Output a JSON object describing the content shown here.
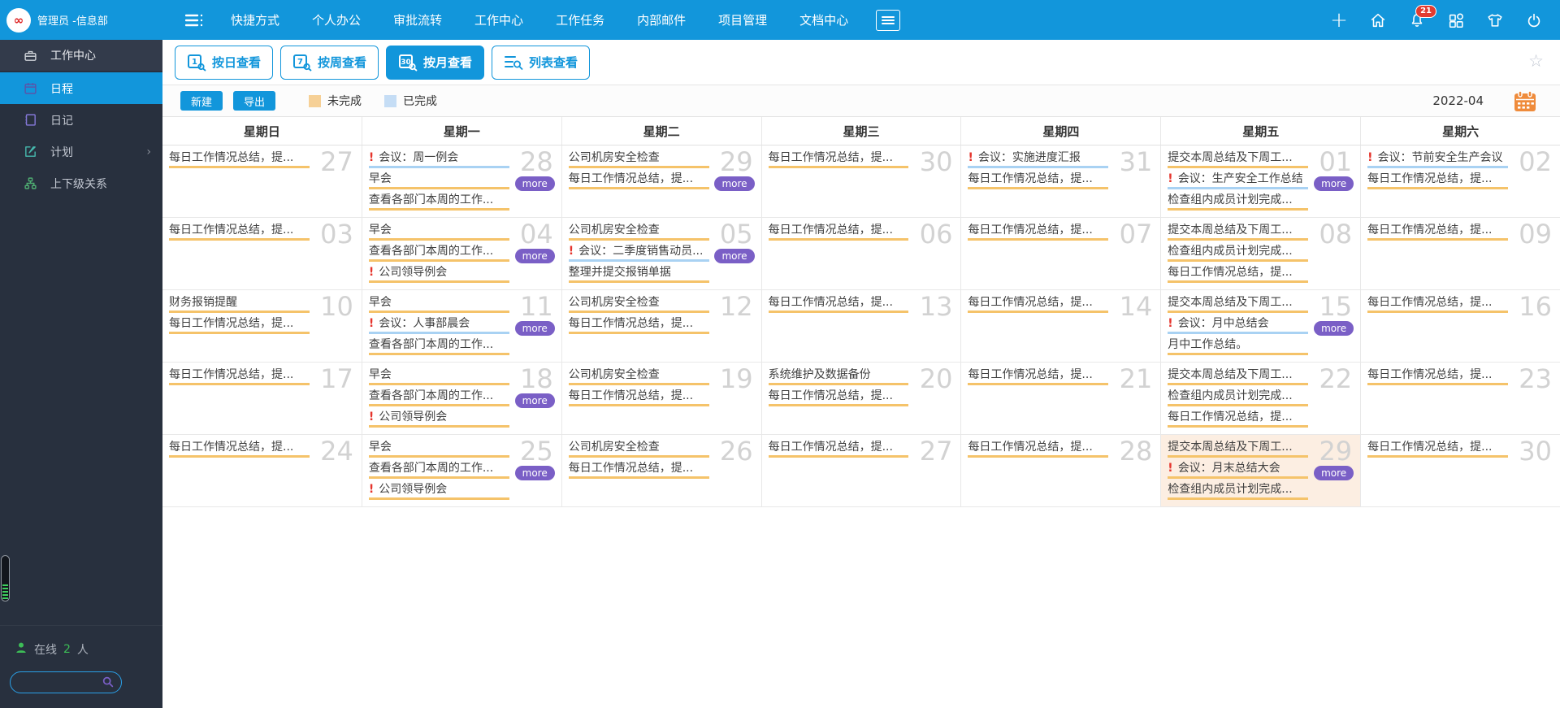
{
  "topbar": {
    "user": "管理员 -信息部",
    "nav_items": [
      "快捷方式",
      "个人办公",
      "审批流转",
      "工作中心",
      "工作任务",
      "内部邮件",
      "项目管理",
      "文档中心"
    ],
    "plus_glyph": "+",
    "notification_count": "21",
    "logo_glyph": "∞"
  },
  "sidebar": {
    "items": [
      {
        "label": "工作中心",
        "icon": "briefcase-icon"
      },
      {
        "label": "日程",
        "icon": "schedule-icon",
        "active": true
      },
      {
        "label": "日记",
        "icon": "diary-icon"
      },
      {
        "label": "计划",
        "icon": "plan-icon",
        "chevron": "›"
      },
      {
        "label": "上下级关系",
        "icon": "hierarchy-icon"
      }
    ],
    "online_label": "在线",
    "online_count": "2",
    "online_unit": "人",
    "search_value": ""
  },
  "toolbar": {
    "view_buttons": [
      {
        "label": "按日查看",
        "badge": "1",
        "active": false
      },
      {
        "label": "按周查看",
        "badge": "7",
        "active": false
      },
      {
        "label": "按月查看",
        "badge": "30",
        "active": true
      },
      {
        "label": "列表查看",
        "badge": "",
        "active": false
      }
    ],
    "new_label": "新建",
    "export_label": "导出",
    "legend": [
      {
        "label": "未完成",
        "color": "#f6d096"
      },
      {
        "label": "已完成",
        "color": "#c5ddf5"
      }
    ],
    "current_month": "2022-04",
    "favorite_glyph": "☆"
  },
  "calendar": {
    "weekday_headers": [
      "星期日",
      "星期一",
      "星期二",
      "星期三",
      "星期四",
      "星期五",
      "星期六"
    ],
    "more_label": "more",
    "important_marker": "!",
    "weeks": [
      [
        {
          "day": "27",
          "events": [
            {
              "text": "每日工作情况总结，提...",
              "status": "incomplete",
              "important": false
            }
          ],
          "more": false,
          "today": false
        },
        {
          "day": "28",
          "events": [
            {
              "text": "会议：周一例会",
              "status": "complete",
              "important": true
            },
            {
              "text": "早会",
              "status": "incomplete",
              "important": false
            },
            {
              "text": "查看各部门本周的工作...",
              "status": "incomplete",
              "important": false
            }
          ],
          "more": true,
          "today": false
        },
        {
          "day": "29",
          "events": [
            {
              "text": "公司机房安全检查",
              "status": "incomplete",
              "important": false
            },
            {
              "text": "每日工作情况总结，提...",
              "status": "incomplete",
              "important": false
            }
          ],
          "more": true,
          "today": false
        },
        {
          "day": "30",
          "events": [
            {
              "text": "每日工作情况总结，提...",
              "status": "incomplete",
              "important": false
            }
          ],
          "more": false,
          "today": false
        },
        {
          "day": "31",
          "events": [
            {
              "text": "会议：实施进度汇报",
              "status": "complete",
              "important": true
            },
            {
              "text": "每日工作情况总结，提...",
              "status": "incomplete",
              "important": false
            }
          ],
          "more": false,
          "today": false
        },
        {
          "day": "01",
          "events": [
            {
              "text": "提交本周总结及下周工...",
              "status": "incomplete",
              "important": false
            },
            {
              "text": "会议：生产安全工作总结",
              "status": "complete",
              "important": true
            },
            {
              "text": "检查组内成员计划完成...",
              "status": "incomplete",
              "important": false
            }
          ],
          "more": true,
          "today": false
        },
        {
          "day": "02",
          "events": [
            {
              "text": "会议：节前安全生产会议",
              "status": "complete",
              "important": true
            },
            {
              "text": "每日工作情况总结，提...",
              "status": "incomplete",
              "important": false
            }
          ],
          "more": false,
          "today": false
        }
      ],
      [
        {
          "day": "03",
          "events": [
            {
              "text": "每日工作情况总结，提...",
              "status": "incomplete",
              "important": false
            }
          ],
          "more": false,
          "today": false
        },
        {
          "day": "04",
          "events": [
            {
              "text": "早会",
              "status": "incomplete",
              "important": false
            },
            {
              "text": "查看各部门本周的工作...",
              "status": "incomplete",
              "important": false
            },
            {
              "text": "公司领导例会",
              "status": "incomplete",
              "important": true
            }
          ],
          "more": true,
          "today": false
        },
        {
          "day": "05",
          "events": [
            {
              "text": "公司机房安全检查",
              "status": "incomplete",
              "important": false
            },
            {
              "text": "会议：二季度销售动员...",
              "status": "complete",
              "important": true
            },
            {
              "text": "整理并提交报销单据",
              "status": "incomplete",
              "important": false
            }
          ],
          "more": true,
          "today": false
        },
        {
          "day": "06",
          "events": [
            {
              "text": "每日工作情况总结，提...",
              "status": "incomplete",
              "important": false
            }
          ],
          "more": false,
          "today": false
        },
        {
          "day": "07",
          "events": [
            {
              "text": "每日工作情况总结，提...",
              "status": "incomplete",
              "important": false
            }
          ],
          "more": false,
          "today": false
        },
        {
          "day": "08",
          "events": [
            {
              "text": "提交本周总结及下周工...",
              "status": "incomplete",
              "important": false
            },
            {
              "text": "检查组内成员计划完成...",
              "status": "incomplete",
              "important": false
            },
            {
              "text": "每日工作情况总结，提...",
              "status": "incomplete",
              "important": false
            }
          ],
          "more": false,
          "today": false
        },
        {
          "day": "09",
          "events": [
            {
              "text": "每日工作情况总结，提...",
              "status": "incomplete",
              "important": false
            }
          ],
          "more": false,
          "today": false
        }
      ],
      [
        {
          "day": "10",
          "events": [
            {
              "text": "财务报销提醒",
              "status": "incomplete",
              "important": false
            },
            {
              "text": "每日工作情况总结，提...",
              "status": "incomplete",
              "important": false
            }
          ],
          "more": false,
          "today": false
        },
        {
          "day": "11",
          "events": [
            {
              "text": "早会",
              "status": "incomplete",
              "important": false
            },
            {
              "text": "会议：人事部晨会",
              "status": "complete",
              "important": true
            },
            {
              "text": "查看各部门本周的工作...",
              "status": "incomplete",
              "important": false
            }
          ],
          "more": true,
          "today": false
        },
        {
          "day": "12",
          "events": [
            {
              "text": "公司机房安全检查",
              "status": "incomplete",
              "important": false
            },
            {
              "text": "每日工作情况总结，提...",
              "status": "incomplete",
              "important": false
            }
          ],
          "more": false,
          "today": false
        },
        {
          "day": "13",
          "events": [
            {
              "text": "每日工作情况总结，提...",
              "status": "incomplete",
              "important": false
            }
          ],
          "more": false,
          "today": false
        },
        {
          "day": "14",
          "events": [
            {
              "text": "每日工作情况总结，提...",
              "status": "incomplete",
              "important": false
            }
          ],
          "more": false,
          "today": false
        },
        {
          "day": "15",
          "events": [
            {
              "text": "提交本周总结及下周工...",
              "status": "incomplete",
              "important": false
            },
            {
              "text": "会议：月中总结会",
              "status": "complete",
              "important": true
            },
            {
              "text": "月中工作总结。",
              "status": "incomplete",
              "important": false
            }
          ],
          "more": true,
          "today": false
        },
        {
          "day": "16",
          "events": [
            {
              "text": "每日工作情况总结，提...",
              "status": "incomplete",
              "important": false
            }
          ],
          "more": false,
          "today": false
        }
      ],
      [
        {
          "day": "17",
          "events": [
            {
              "text": "每日工作情况总结，提...",
              "status": "incomplete",
              "important": false
            }
          ],
          "more": false,
          "today": false
        },
        {
          "day": "18",
          "events": [
            {
              "text": "早会",
              "status": "incomplete",
              "important": false
            },
            {
              "text": "查看各部门本周的工作...",
              "status": "incomplete",
              "important": false
            },
            {
              "text": "公司领导例会",
              "status": "incomplete",
              "important": true
            }
          ],
          "more": true,
          "today": false
        },
        {
          "day": "19",
          "events": [
            {
              "text": "公司机房安全检查",
              "status": "incomplete",
              "important": false
            },
            {
              "text": "每日工作情况总结，提...",
              "status": "incomplete",
              "important": false
            }
          ],
          "more": false,
          "today": false
        },
        {
          "day": "20",
          "events": [
            {
              "text": "系统维护及数据备份",
              "status": "incomplete",
              "important": false
            },
            {
              "text": "每日工作情况总结，提...",
              "status": "incomplete",
              "important": false
            }
          ],
          "more": false,
          "today": false
        },
        {
          "day": "21",
          "events": [
            {
              "text": "每日工作情况总结，提...",
              "status": "incomplete",
              "important": false
            }
          ],
          "more": false,
          "today": false
        },
        {
          "day": "22",
          "events": [
            {
              "text": "提交本周总结及下周工...",
              "status": "incomplete",
              "important": false
            },
            {
              "text": "检查组内成员计划完成...",
              "status": "incomplete",
              "important": false
            },
            {
              "text": "每日工作情况总结，提...",
              "status": "incomplete",
              "important": false
            }
          ],
          "more": false,
          "today": false
        },
        {
          "day": "23",
          "events": [
            {
              "text": "每日工作情况总结，提...",
              "status": "incomplete",
              "important": false
            }
          ],
          "more": false,
          "today": false
        }
      ],
      [
        {
          "day": "24",
          "events": [
            {
              "text": "每日工作情况总结，提...",
              "status": "incomplete",
              "important": false
            }
          ],
          "more": false,
          "today": false
        },
        {
          "day": "25",
          "events": [
            {
              "text": "早会",
              "status": "incomplete",
              "important": false
            },
            {
              "text": "查看各部门本周的工作...",
              "status": "incomplete",
              "important": false
            },
            {
              "text": "公司领导例会",
              "status": "incomplete",
              "important": true
            }
          ],
          "more": true,
          "today": false
        },
        {
          "day": "26",
          "events": [
            {
              "text": "公司机房安全检查",
              "status": "incomplete",
              "important": false
            },
            {
              "text": "每日工作情况总结，提...",
              "status": "incomplete",
              "important": false
            }
          ],
          "more": false,
          "today": false
        },
        {
          "day": "27",
          "events": [
            {
              "text": "每日工作情况总结，提...",
              "status": "incomplete",
              "important": false
            }
          ],
          "more": false,
          "today": false
        },
        {
          "day": "28",
          "events": [
            {
              "text": "每日工作情况总结，提...",
              "status": "incomplete",
              "important": false
            }
          ],
          "more": false,
          "today": false
        },
        {
          "day": "29",
          "events": [
            {
              "text": "提交本周总结及下周工...",
              "status": "incomplete",
              "important": false
            },
            {
              "text": "会议：月末总结大会",
              "status": "incomplete",
              "important": true
            },
            {
              "text": "检查组内成员计划完成...",
              "status": "incomplete",
              "important": false
            }
          ],
          "more": true,
          "today": true
        },
        {
          "day": "30",
          "events": [
            {
              "text": "每日工作情况总结，提...",
              "status": "incomplete",
              "important": false
            }
          ],
          "more": false,
          "today": false
        }
      ]
    ]
  },
  "colors": {
    "primary": "#1296db",
    "sidebar_bg": "#28303e",
    "sidebar_section_bg": "#333b4b",
    "incomplete_underline": "#f5c36a",
    "complete_underline": "#a9d2f3",
    "more_badge": "#7a5fc6",
    "today_cell_bg": "#fceee2",
    "important_marker": "#e5342c",
    "day_number": "#d2d2d2",
    "notification_badge": "#e23c31",
    "calendar_icon": "#ef8b3b",
    "online_green": "#3dbd57"
  }
}
